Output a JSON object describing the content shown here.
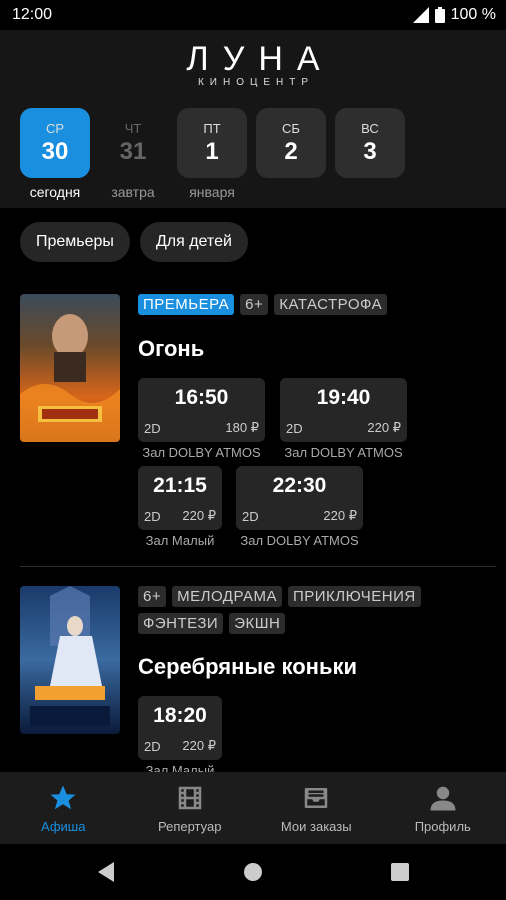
{
  "status": {
    "time": "12:00",
    "battery": "100 %"
  },
  "logo": {
    "main": "ЛУНА",
    "sub": "КИНОЦЕНТР"
  },
  "dates": [
    {
      "dow": "СР",
      "num": "30",
      "caption": "сегодня",
      "state": "active"
    },
    {
      "dow": "ЧТ",
      "num": "31",
      "caption": "завтра",
      "state": "disabled"
    },
    {
      "dow": "ПТ",
      "num": "1",
      "caption": "января",
      "state": "normal"
    },
    {
      "dow": "СБ",
      "num": "2",
      "caption": "",
      "state": "normal"
    },
    {
      "dow": "ВС",
      "num": "3",
      "caption": "",
      "state": "normal"
    }
  ],
  "filters": [
    "Премьеры",
    "Для детей"
  ],
  "movies": [
    {
      "title": "Огонь",
      "tags": [
        "ПРЕМЬЕРА",
        "6+",
        "КАТАСТРОФА"
      ],
      "sessions": [
        {
          "time": "16:50",
          "format": "2D",
          "price": "180 ₽",
          "hall": "Зал DOLBY ATMOS"
        },
        {
          "time": "19:40",
          "format": "2D",
          "price": "220 ₽",
          "hall": "Зал DOLBY ATMOS"
        },
        {
          "time": "21:15",
          "format": "2D",
          "price": "220 ₽",
          "hall": "Зал Малый"
        },
        {
          "time": "22:30",
          "format": "2D",
          "price": "220 ₽",
          "hall": "Зал DOLBY ATMOS"
        }
      ]
    },
    {
      "title": "Серебряные коньки",
      "tags": [
        "6+",
        "МЕЛОДРАМА",
        "ПРИКЛЮЧЕНИЯ",
        "ФЭНТЕЗИ",
        "ЭКШН"
      ],
      "sessions": [
        {
          "time": "18:20",
          "format": "2D",
          "price": "220 ₽",
          "hall": "Зал Малый"
        }
      ]
    }
  ],
  "nav": [
    {
      "label": "Афиша",
      "icon": "star-icon",
      "active": true
    },
    {
      "label": "Репертуар",
      "icon": "film-icon",
      "active": false
    },
    {
      "label": "Мои заказы",
      "icon": "tray-icon",
      "active": false
    },
    {
      "label": "Профиль",
      "icon": "person-icon",
      "active": false
    }
  ],
  "colors": {
    "accent": "#1a8fe0",
    "background": "#000000",
    "header": "#161616"
  }
}
